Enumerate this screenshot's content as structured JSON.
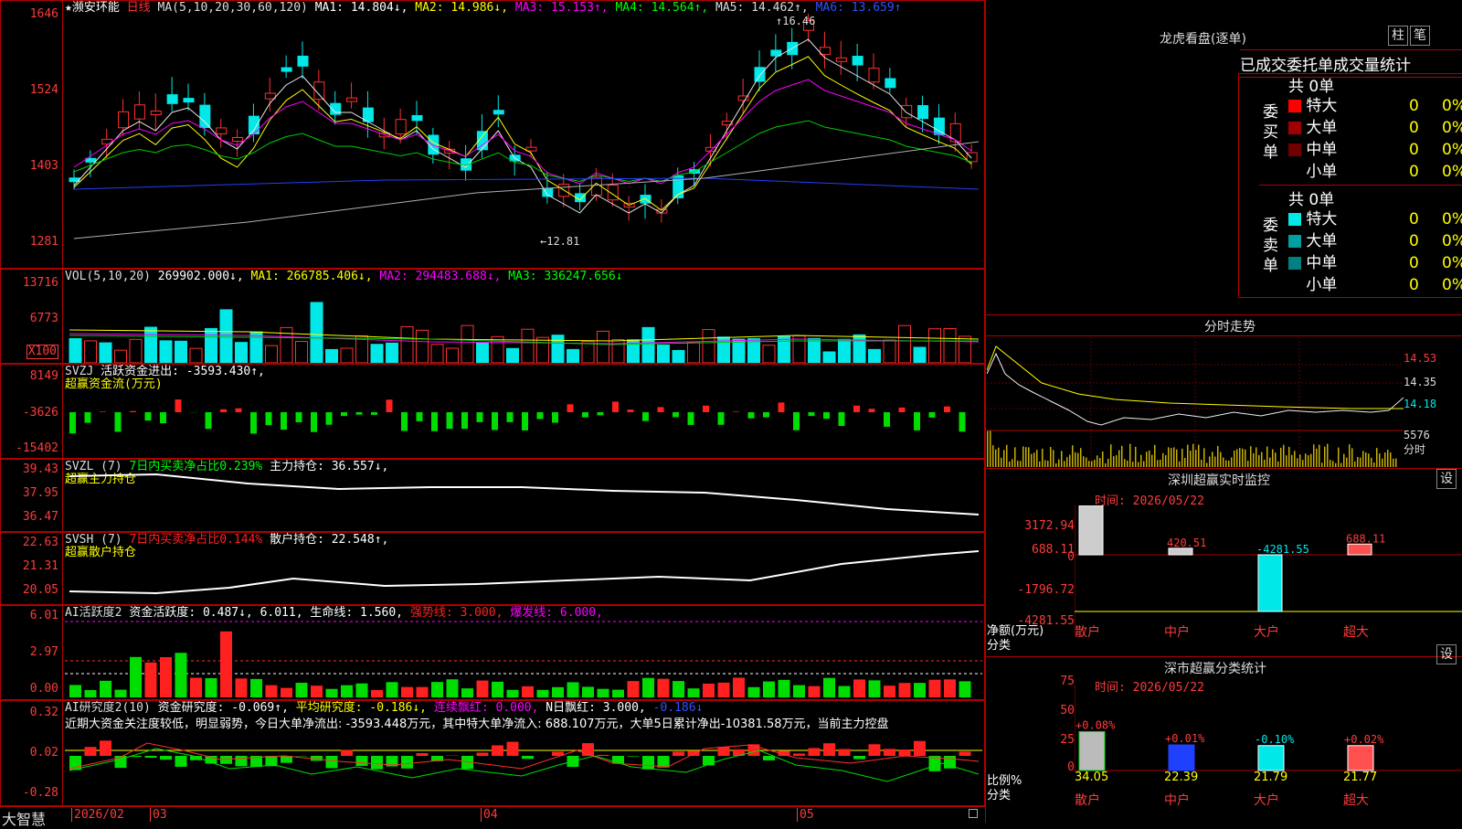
{
  "stock": {
    "name": "★濒安环能",
    "period": "日线",
    "ma_params": "MA(5,10,20,30,60,120)",
    "ma": [
      "MA1: 14.804↓,",
      "MA2: 14.986↓,",
      "MA3: 15.153↑,",
      "MA4: 14.564↑,",
      "MA5: 14.462↑,",
      "MA6: 13.659↑"
    ],
    "high_mark": "16.46",
    "low_mark": "←12.81",
    "axis": [
      "1646",
      "1524",
      "1403",
      "1281"
    ]
  },
  "vol": {
    "label": "VOL(5,10,20)",
    "v": "269902.000↓,",
    "ma1": "MA1: 266785.406↓,",
    "ma2": "MA2: 294483.688↓,",
    "ma3": "MA3: 336247.656↓",
    "axis": [
      "13716",
      "6773",
      "X100"
    ]
  },
  "svzj": {
    "label": "SVZJ",
    "desc": "活跃资金进出: -3593.430↑,",
    "sub": "超赢资金流(万元)",
    "axis": [
      "8149",
      "-3626",
      "-15402"
    ]
  },
  "svzl": {
    "label": "SVZL (7)",
    "desc1": "7日内买卖净占比0.239%",
    "desc2": "主力持仓: 36.557↓,",
    "sub": "超赢主力持仓",
    "axis": [
      "39.43",
      "37.95",
      "36.47"
    ]
  },
  "svsh": {
    "label": "SVSH (7)",
    "desc1": "7日内买卖净占比0.144%",
    "desc2": "散户持仓: 22.548↑,",
    "sub": "超赢散户持仓",
    "axis": [
      "22.63",
      "21.31",
      "20.05"
    ]
  },
  "ai1": {
    "label": "AI活跃度2",
    "desc": "资金活跃度: 0.487↓, 6.011, 生命线: 1.560,",
    "strong": "强势线: 3.000,",
    "burst": "爆发线: 6.000,",
    "axis": [
      "6.01",
      "2.97",
      "0.00"
    ]
  },
  "ai2": {
    "label": "AI研究度2(10)",
    "desc": "资金研究度: -0.069↑,",
    "avg": "平均研究度: -0.186↓,",
    "red": "连续飘红: 0.000,",
    "n": "N日飘红: 3.000,",
    "last": "-0.186↓",
    "comment": "近期大资金关注度较低，明显弱势，今日大单净流出: -3593.448万元，其中特大单净流入: 688.107万元，大单5日累计净出-10381.58万元，当前主力控盘",
    "axis": [
      "0.32",
      "0.02",
      "-0.28"
    ]
  },
  "footer": {
    "brand": "大智慧",
    "date": "2026/02",
    "m1": "03",
    "m2": "04",
    "m3": "05"
  },
  "right": {
    "title": "龙虎看盘(逐单)",
    "btn1": "柱",
    "btn2": "笔",
    "stat_title": "已成交委托单成交量统计",
    "buy_label": "委买单",
    "sell_label": "委卖单",
    "buy_total": "共 0单",
    "sell_total": "共 0单",
    "buy_rows": [
      {
        "name": "特大",
        "v": "0",
        "p": "0%",
        "c": "#ff0000"
      },
      {
        "name": "大单",
        "v": "0",
        "p": "0%",
        "c": "#a00000"
      },
      {
        "name": "中单",
        "v": "0",
        "p": "0%",
        "c": "#700000"
      },
      {
        "name": "小单",
        "v": "0",
        "p": "0%",
        "c": "#000000"
      }
    ],
    "sell_rows": [
      {
        "name": "特大",
        "v": "0",
        "p": "0%",
        "c": "#00e8e8"
      },
      {
        "name": "大单",
        "v": "0",
        "p": "0%",
        "c": "#00a0a0"
      },
      {
        "name": "中单",
        "v": "0",
        "p": "0%",
        "c": "#008080"
      },
      {
        "name": "小单",
        "v": "0",
        "p": "0%",
        "c": "#000000"
      }
    ],
    "intraday_title": "分时走势",
    "intraday_axis": [
      "14.53",
      "14.35",
      "14.18",
      "5576",
      "分时"
    ],
    "monitor_title": "深圳超赢实时监控",
    "set": "设",
    "time": "时间: 2026/05/22",
    "monitor_axis": [
      "3172.94",
      "688.11",
      "0",
      "-1796.72",
      "-4281.55"
    ],
    "monitor_unit": "净额(万元)",
    "cls": "分类",
    "monitor_vals": [
      "3172.94",
      "420.51",
      "-4281.55",
      "688.11"
    ],
    "cats": [
      "散户",
      "中户",
      "大户",
      "超大"
    ],
    "class_title": "深市超赢分类统计",
    "class_axis": [
      "75",
      "50",
      "25",
      "0"
    ],
    "ratio": "比例%",
    "class_pcts": [
      "+0.08%",
      "+0.01%",
      "-0.10%",
      "+0.02%"
    ],
    "class_vals": [
      "34.05",
      "22.39",
      "21.79",
      "21.77"
    ]
  }
}
